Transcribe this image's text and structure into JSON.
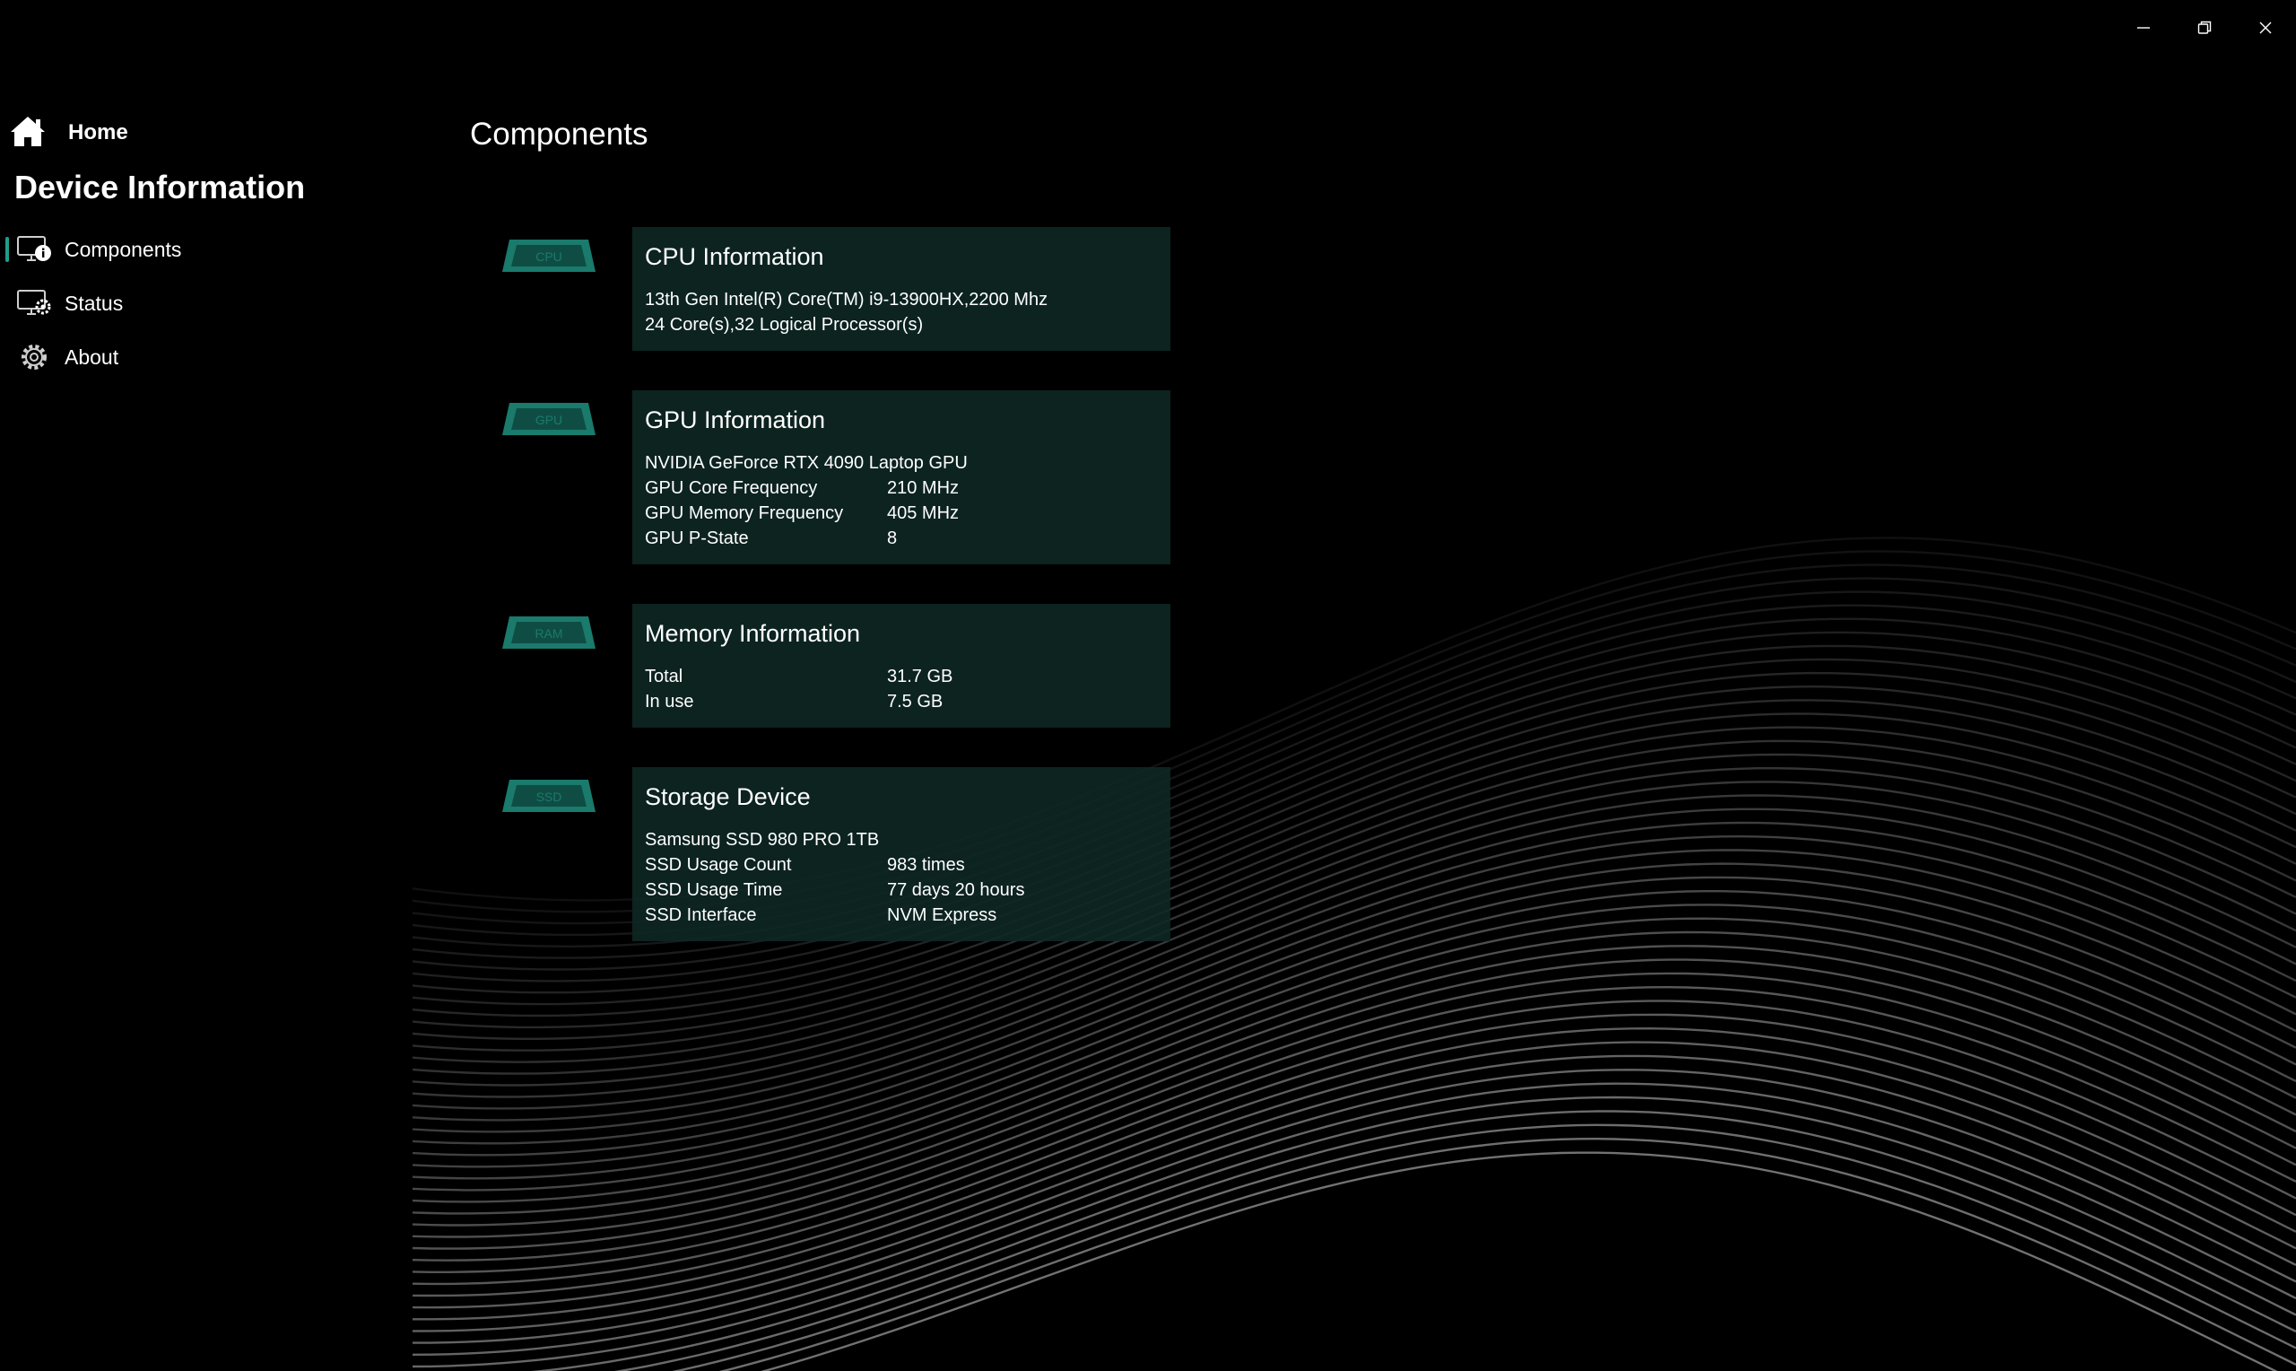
{
  "window": {
    "minimize_icon": "minimize-icon",
    "restore_icon": "restore-icon",
    "close_icon": "close-icon"
  },
  "sidebar": {
    "home_label": "Home",
    "home_icon": "home-icon",
    "app_title": "Device Information",
    "items": [
      {
        "label": "Components",
        "icon": "monitor-info-icon",
        "selected": true
      },
      {
        "label": "Status",
        "icon": "monitor-gear-icon",
        "selected": false
      },
      {
        "label": "About",
        "icon": "gear-icon",
        "selected": false
      }
    ]
  },
  "main": {
    "title": "Components",
    "cpu": {
      "icon": "cpu-chip-icon",
      "chip_text": "CPU",
      "title": "CPU Information",
      "model": "13th Gen Intel(R) Core(TM) i9-13900HX,2200 Mhz",
      "cores": "24 Core(s),32 Logical Processor(s)"
    },
    "gpu": {
      "icon": "gpu-chip-icon",
      "chip_text": "GPU",
      "title": "GPU Information",
      "model": "NVIDIA GeForce RTX 4090 Laptop GPU",
      "rows": [
        {
          "key": "GPU Core Frequency",
          "value": "210 MHz"
        },
        {
          "key": "GPU Memory Frequency",
          "value": "405 MHz"
        },
        {
          "key": "GPU P-State",
          "value": "8"
        }
      ]
    },
    "memory": {
      "icon": "ram-chip-icon",
      "chip_text": "RAM",
      "title": "Memory Information",
      "rows": [
        {
          "key": "Total",
          "value": "31.7 GB"
        },
        {
          "key": "In use",
          "value": "7.5 GB"
        }
      ]
    },
    "storage": {
      "icon": "ssd-chip-icon",
      "chip_text": "SSD",
      "title": "Storage Device",
      "model": "Samsung SSD 980 PRO 1TB",
      "rows": [
        {
          "key": "SSD Usage Count",
          "value": "983 times"
        },
        {
          "key": "SSD Usage Time",
          "value": "77 days 20 hours"
        },
        {
          "key": "SSD Interface",
          "value": "NVM Express"
        }
      ]
    }
  },
  "colors": {
    "background": "#000000",
    "card_background": "#0e2824",
    "accent": "#1f9e8a",
    "chip_teal": "#1a7a6c"
  }
}
